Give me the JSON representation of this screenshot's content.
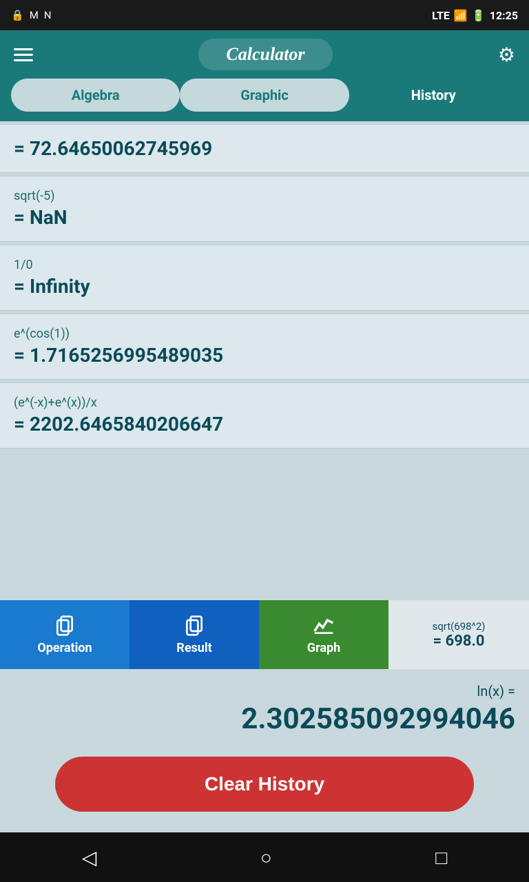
{
  "statusBar": {
    "time": "12:25",
    "signal": "LTE"
  },
  "header": {
    "title": "Calculator",
    "menuLabel": "menu",
    "settingsLabel": "settings"
  },
  "tabs": [
    {
      "id": "algebra",
      "label": "Algebra",
      "active": false
    },
    {
      "id": "graphic",
      "label": "Graphic",
      "active": false
    },
    {
      "id": "history",
      "label": "History",
      "active": true
    }
  ],
  "historyItems": [
    {
      "expr": "= 72.64650062745969",
      "result": ""
    },
    {
      "expr": "sqrt(-5)",
      "result": "= NaN"
    },
    {
      "expr": "1/0",
      "result": "= Infinity"
    },
    {
      "expr": "e^(cos(1))",
      "result": "= 1.7165256995489035"
    },
    {
      "expr": "(e^(-x)+e^(x))/x",
      "result": "= 2202.6465840206647"
    }
  ],
  "actionBar": {
    "operationLabel": "Operation",
    "resultLabel": "Result",
    "graphLabel": "Graph",
    "lastExpr": "sqrt(698^2)",
    "lastResult": "= 698.0"
  },
  "lnSection": {
    "label": "ln(x) =",
    "value": "2.302585092994046"
  },
  "clearButton": {
    "label": "Clear History"
  },
  "navBar": {
    "backLabel": "back",
    "homeLabel": "home",
    "recentLabel": "recent"
  }
}
